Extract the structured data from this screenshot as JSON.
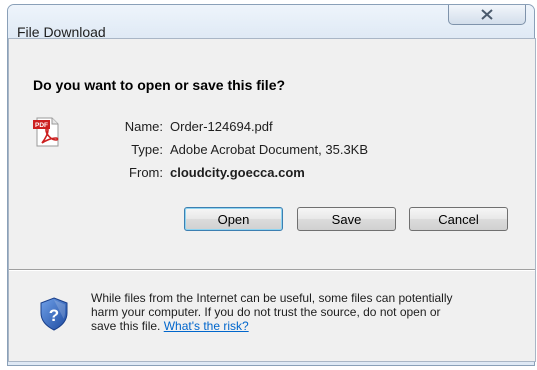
{
  "window": {
    "title": "File Download"
  },
  "dialog": {
    "question": "Do you want to open or save this file?",
    "file": {
      "name_label": "Name:",
      "name_value": "Order-124694.pdf",
      "type_label": "Type:",
      "type_value": "Adobe Acrobat Document, 35.3KB",
      "from_label": "From:",
      "from_value": "cloudcity.goecca.com",
      "icon": "pdf-icon",
      "icon_badge": "PDF"
    },
    "buttons": {
      "open": "Open",
      "save": "Save",
      "cancel": "Cancel"
    },
    "warning": {
      "text_line1": "While files from the Internet can be useful, some files can potentially",
      "text_line2": "harm your computer. If you do not trust the source, do not open or",
      "text_line3": "save this file. ",
      "link": "What's the risk?",
      "icon": "shield-question-icon"
    }
  },
  "colors": {
    "title_bar": "#dfe9f5",
    "client_bg": "#f0f0f0",
    "link": "#0066cc",
    "pdf_red": "#cc1f1f",
    "shield_blue": "#2a5cb8"
  }
}
